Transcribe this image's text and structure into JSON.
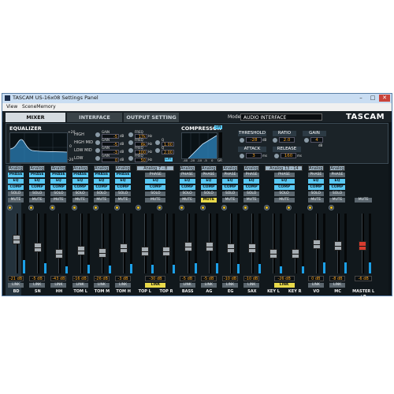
{
  "window": {
    "title": "TASCAM US-16x08 Settings Panel",
    "buttons": [
      "–",
      "□",
      "✕"
    ]
  },
  "menu": [
    "View",
    "SceneMemory"
  ],
  "tabs": [
    {
      "label": "MIXER",
      "active": true
    },
    {
      "label": "INTERFACE",
      "active": false
    },
    {
      "label": "OUTPUT SETTING",
      "active": false
    }
  ],
  "mode": {
    "label": "Mode",
    "value": "AUDIO INTERFACE"
  },
  "brand": "TASCAM",
  "equalizer": {
    "title": "EQUALIZER",
    "bands": [
      {
        "label": "HIGH",
        "gain_label": "GAIN",
        "gain": "-5",
        "gain_unit": "dB",
        "freq_label": "FREQ",
        "freq": "17k",
        "freq_unit": "Hz"
      },
      {
        "label": "HIGH MID",
        "gain_label": "GAIN",
        "gain": "-5",
        "gain_unit": "dB",
        "freq_label": "FREQ",
        "freq": "6k",
        "freq_unit": "Hz",
        "q_label": "Q",
        "q": "1.00"
      },
      {
        "label": "LOW MID",
        "gain_label": "GAIN",
        "gain": "-3",
        "gain_unit": "dB",
        "freq_label": "FREQ",
        "freq": "100",
        "freq_unit": "Hz",
        "q_label": "Q",
        "q": "2.00"
      },
      {
        "label": "LOW",
        "gain_label": "GAIN",
        "gain": "0",
        "gain_unit": "dB",
        "freq_label": "FREQ",
        "freq": "50",
        "freq_unit": "Hz"
      }
    ],
    "scale_marks": [
      "+20",
      "0",
      "-20"
    ]
  },
  "compressor": {
    "title": "COMPRESSOR",
    "graph_axis": [
      "-40",
      "-20",
      "-10",
      "-5",
      "0"
    ],
    "gr_label": "GR",
    "threshold": {
      "label": "THRESHOLD",
      "value": "-28",
      "unit": "dB"
    },
    "ratio": {
      "label": "RATIO",
      "value": "2.0"
    },
    "gain": {
      "label": "GAIN",
      "value": "4",
      "unit": "dB"
    },
    "attack": {
      "label": "ATTACK",
      "value": "3",
      "unit": "ms"
    },
    "release": {
      "label": "RELEASE",
      "value": "160",
      "unit": "ms"
    },
    "badges": [
      "ON",
      "LPF"
    ]
  },
  "strip_buttons": {
    "phase": "PHASE",
    "eq": "EQ",
    "comp": "COMP",
    "solo": "SOLO",
    "mute": "MUTE",
    "link": "LINK"
  },
  "channels": [
    {
      "input": "Analog 1",
      "name": "BD",
      "db": "-21 dB",
      "selected": true,
      "level": 0.58
    },
    {
      "input": "Analog 2",
      "name": "SN",
      "db": "-5 dB",
      "level": 0.42
    },
    {
      "input": "Analog 3",
      "name": "HH",
      "db": "-43 dB",
      "level": 0.3
    },
    {
      "input": "Analog 4",
      "name": "TOM L",
      "db": "-16 dB",
      "level": 0.36
    },
    {
      "input": "Analog 5",
      "name": "TOM M",
      "db": "-26 dB",
      "level": 0.32
    },
    {
      "input": "Analog 6",
      "name": "TOM H",
      "db": "-3 dB",
      "level": 0.4
    },
    {
      "input": "Analog 7 - 8",
      "name": "TOP L",
      "db": "-30 dB",
      "stereo_first": true,
      "level": 0.35
    },
    {
      "input": "",
      "name": "TOP R",
      "db": "",
      "stereo_second": true,
      "level": 0.35
    },
    {
      "input": "Analog 9",
      "name": "BASS",
      "db": "-5 dB",
      "level": 0.44
    },
    {
      "input": "Analog 10",
      "name": "AG",
      "db": "-5 dB",
      "mute_on": true,
      "level": 0.44
    },
    {
      "input": "Analog 11",
      "name": "EG",
      "db": "-10 dB",
      "level": 0.4
    },
    {
      "input": "Analog 12",
      "name": "SAX",
      "db": "-10 dB",
      "level": 0.4
    },
    {
      "input": "Analog 13 - 14",
      "name": "KEY L",
      "db": "-26 dB",
      "stereo_first": true,
      "level": 0.3
    },
    {
      "input": "",
      "name": "KEY R",
      "db": "",
      "stereo_second": true,
      "level": 0.3
    },
    {
      "input": "Analog 15",
      "name": "VO",
      "db": "0 dB",
      "level": 0.48
    },
    {
      "input": "Analog 16",
      "name": "MC",
      "db": "-8 dB",
      "level": 0.45
    }
  ],
  "master": {
    "name": "MASTER L / R",
    "db": "-6 dB",
    "mute": "MUTE",
    "level": 0.46
  }
}
